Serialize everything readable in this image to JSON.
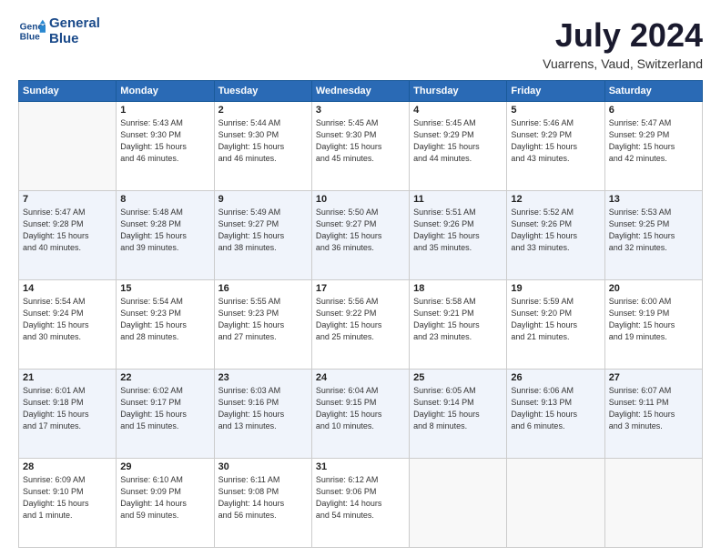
{
  "logo": {
    "line1": "General",
    "line2": "Blue"
  },
  "title": "July 2024",
  "subtitle": "Vuarrens, Vaud, Switzerland",
  "days_header": [
    "Sunday",
    "Monday",
    "Tuesday",
    "Wednesday",
    "Thursday",
    "Friday",
    "Saturday"
  ],
  "weeks": [
    [
      {
        "num": "",
        "info": ""
      },
      {
        "num": "1",
        "info": "Sunrise: 5:43 AM\nSunset: 9:30 PM\nDaylight: 15 hours\nand 46 minutes."
      },
      {
        "num": "2",
        "info": "Sunrise: 5:44 AM\nSunset: 9:30 PM\nDaylight: 15 hours\nand 46 minutes."
      },
      {
        "num": "3",
        "info": "Sunrise: 5:45 AM\nSunset: 9:30 PM\nDaylight: 15 hours\nand 45 minutes."
      },
      {
        "num": "4",
        "info": "Sunrise: 5:45 AM\nSunset: 9:29 PM\nDaylight: 15 hours\nand 44 minutes."
      },
      {
        "num": "5",
        "info": "Sunrise: 5:46 AM\nSunset: 9:29 PM\nDaylight: 15 hours\nand 43 minutes."
      },
      {
        "num": "6",
        "info": "Sunrise: 5:47 AM\nSunset: 9:29 PM\nDaylight: 15 hours\nand 42 minutes."
      }
    ],
    [
      {
        "num": "7",
        "info": "Sunrise: 5:47 AM\nSunset: 9:28 PM\nDaylight: 15 hours\nand 40 minutes."
      },
      {
        "num": "8",
        "info": "Sunrise: 5:48 AM\nSunset: 9:28 PM\nDaylight: 15 hours\nand 39 minutes."
      },
      {
        "num": "9",
        "info": "Sunrise: 5:49 AM\nSunset: 9:27 PM\nDaylight: 15 hours\nand 38 minutes."
      },
      {
        "num": "10",
        "info": "Sunrise: 5:50 AM\nSunset: 9:27 PM\nDaylight: 15 hours\nand 36 minutes."
      },
      {
        "num": "11",
        "info": "Sunrise: 5:51 AM\nSunset: 9:26 PM\nDaylight: 15 hours\nand 35 minutes."
      },
      {
        "num": "12",
        "info": "Sunrise: 5:52 AM\nSunset: 9:26 PM\nDaylight: 15 hours\nand 33 minutes."
      },
      {
        "num": "13",
        "info": "Sunrise: 5:53 AM\nSunset: 9:25 PM\nDaylight: 15 hours\nand 32 minutes."
      }
    ],
    [
      {
        "num": "14",
        "info": "Sunrise: 5:54 AM\nSunset: 9:24 PM\nDaylight: 15 hours\nand 30 minutes."
      },
      {
        "num": "15",
        "info": "Sunrise: 5:54 AM\nSunset: 9:23 PM\nDaylight: 15 hours\nand 28 minutes."
      },
      {
        "num": "16",
        "info": "Sunrise: 5:55 AM\nSunset: 9:23 PM\nDaylight: 15 hours\nand 27 minutes."
      },
      {
        "num": "17",
        "info": "Sunrise: 5:56 AM\nSunset: 9:22 PM\nDaylight: 15 hours\nand 25 minutes."
      },
      {
        "num": "18",
        "info": "Sunrise: 5:58 AM\nSunset: 9:21 PM\nDaylight: 15 hours\nand 23 minutes."
      },
      {
        "num": "19",
        "info": "Sunrise: 5:59 AM\nSunset: 9:20 PM\nDaylight: 15 hours\nand 21 minutes."
      },
      {
        "num": "20",
        "info": "Sunrise: 6:00 AM\nSunset: 9:19 PM\nDaylight: 15 hours\nand 19 minutes."
      }
    ],
    [
      {
        "num": "21",
        "info": "Sunrise: 6:01 AM\nSunset: 9:18 PM\nDaylight: 15 hours\nand 17 minutes."
      },
      {
        "num": "22",
        "info": "Sunrise: 6:02 AM\nSunset: 9:17 PM\nDaylight: 15 hours\nand 15 minutes."
      },
      {
        "num": "23",
        "info": "Sunrise: 6:03 AM\nSunset: 9:16 PM\nDaylight: 15 hours\nand 13 minutes."
      },
      {
        "num": "24",
        "info": "Sunrise: 6:04 AM\nSunset: 9:15 PM\nDaylight: 15 hours\nand 10 minutes."
      },
      {
        "num": "25",
        "info": "Sunrise: 6:05 AM\nSunset: 9:14 PM\nDaylight: 15 hours\nand 8 minutes."
      },
      {
        "num": "26",
        "info": "Sunrise: 6:06 AM\nSunset: 9:13 PM\nDaylight: 15 hours\nand 6 minutes."
      },
      {
        "num": "27",
        "info": "Sunrise: 6:07 AM\nSunset: 9:11 PM\nDaylight: 15 hours\nand 3 minutes."
      }
    ],
    [
      {
        "num": "28",
        "info": "Sunrise: 6:09 AM\nSunset: 9:10 PM\nDaylight: 15 hours\nand 1 minute."
      },
      {
        "num": "29",
        "info": "Sunrise: 6:10 AM\nSunset: 9:09 PM\nDaylight: 14 hours\nand 59 minutes."
      },
      {
        "num": "30",
        "info": "Sunrise: 6:11 AM\nSunset: 9:08 PM\nDaylight: 14 hours\nand 56 minutes."
      },
      {
        "num": "31",
        "info": "Sunrise: 6:12 AM\nSunset: 9:06 PM\nDaylight: 14 hours\nand 54 minutes."
      },
      {
        "num": "",
        "info": ""
      },
      {
        "num": "",
        "info": ""
      },
      {
        "num": "",
        "info": ""
      }
    ]
  ]
}
